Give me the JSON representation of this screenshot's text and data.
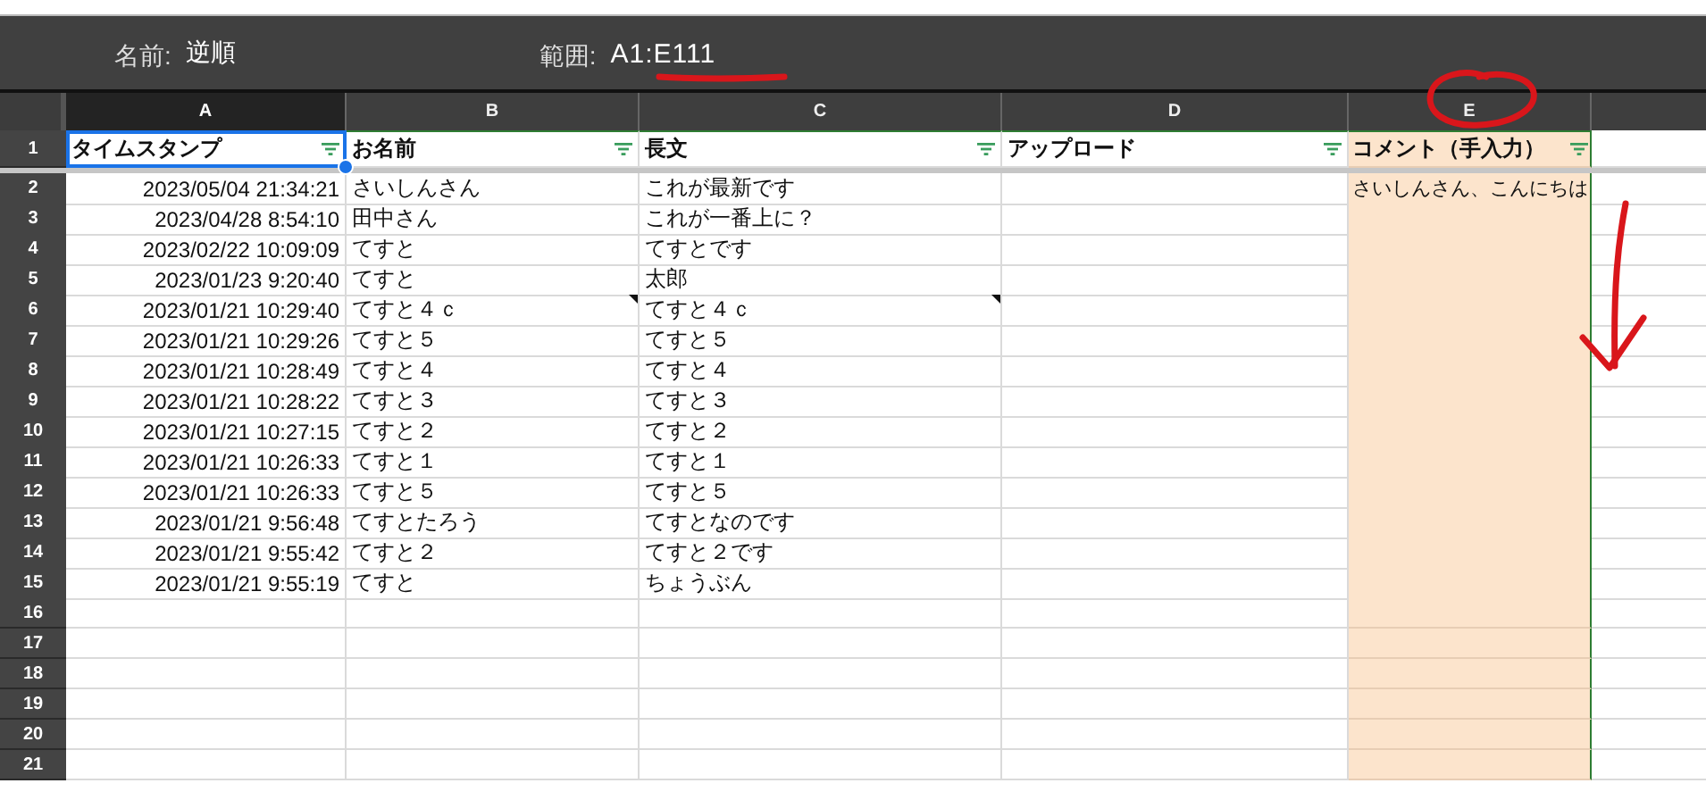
{
  "named_range": {
    "name_label": "名前:",
    "name": "逆順",
    "range_label": "範囲:",
    "range": "A1:E111"
  },
  "columns": [
    {
      "label": "A",
      "selected": true,
      "highlighted": false
    },
    {
      "label": "B",
      "selected": false,
      "highlighted": false
    },
    {
      "label": "C",
      "selected": false,
      "highlighted": false
    },
    {
      "label": "D",
      "selected": false,
      "highlighted": false
    },
    {
      "label": "E",
      "selected": false,
      "highlighted": true
    }
  ],
  "header_row": {
    "row": "1",
    "cells": [
      {
        "text": "タイムスタンプ",
        "selected": true,
        "filter": true
      },
      {
        "text": "お名前",
        "selected": false,
        "filter": true
      },
      {
        "text": "長文",
        "selected": false,
        "filter": true
      },
      {
        "text": "アップロード",
        "selected": false,
        "filter": true
      },
      {
        "text": "コメント（手入力）",
        "selected": false,
        "filter": true
      }
    ]
  },
  "rows": [
    {
      "row": "2",
      "timestamp": "2023/05/04 21:34:21",
      "name": "さいしんさん",
      "body": "これが最新です",
      "comment": "さいしんさん、こんにちは",
      "name_note": false,
      "body_note": false
    },
    {
      "row": "3",
      "timestamp": "2023/04/28 8:54:10",
      "name": "田中さん",
      "body": "これが一番上に？",
      "name_note": false,
      "body_note": false
    },
    {
      "row": "4",
      "timestamp": "2023/02/22 10:09:09",
      "name": "てすと",
      "body": "てすとです",
      "name_note": false,
      "body_note": false
    },
    {
      "row": "5",
      "timestamp": "2023/01/23 9:20:40",
      "name": "てすと",
      "body": "太郎",
      "name_note": false,
      "body_note": false
    },
    {
      "row": "6",
      "timestamp": "2023/01/21 10:29:40",
      "name": "てすと４ｃ",
      "body": "てすと４ｃ",
      "name_note": true,
      "body_note": true
    },
    {
      "row": "7",
      "timestamp": "2023/01/21 10:29:26",
      "name": "てすと５",
      "body": "てすと５",
      "name_note": false,
      "body_note": false
    },
    {
      "row": "8",
      "timestamp": "2023/01/21 10:28:49",
      "name": "てすと４",
      "body": "てすと４",
      "name_note": false,
      "body_note": false
    },
    {
      "row": "9",
      "timestamp": "2023/01/21 10:28:22",
      "name": "てすと３",
      "body": "てすと３",
      "name_note": false,
      "body_note": false
    },
    {
      "row": "10",
      "timestamp": "2023/01/21 10:27:15",
      "name": "てすと２",
      "body": "てすと２",
      "name_note": false,
      "body_note": false
    },
    {
      "row": "11",
      "timestamp": "2023/01/21 10:26:33",
      "name": "てすと１",
      "body": "てすと１",
      "name_note": false,
      "body_note": false
    },
    {
      "row": "12",
      "timestamp": "2023/01/21 10:26:33",
      "name": "てすと５",
      "body": "てすと５",
      "name_note": false,
      "body_note": false
    },
    {
      "row": "13",
      "timestamp": "2023/01/21 9:56:48",
      "name": "てすとたろう",
      "body": "てすとなのです",
      "name_note": false,
      "body_note": false
    },
    {
      "row": "14",
      "timestamp": "2023/01/21 9:55:42",
      "name": "てすと２",
      "body": "てすと２です",
      "name_note": false,
      "body_note": false
    },
    {
      "row": "15",
      "timestamp": "2023/01/21 9:55:19",
      "name": "てすと",
      "body": "ちょうぶん",
      "name_note": false,
      "body_note": false
    }
  ],
  "empty_rows": [
    "16",
    "17",
    "18",
    "19",
    "20",
    "21"
  ]
}
